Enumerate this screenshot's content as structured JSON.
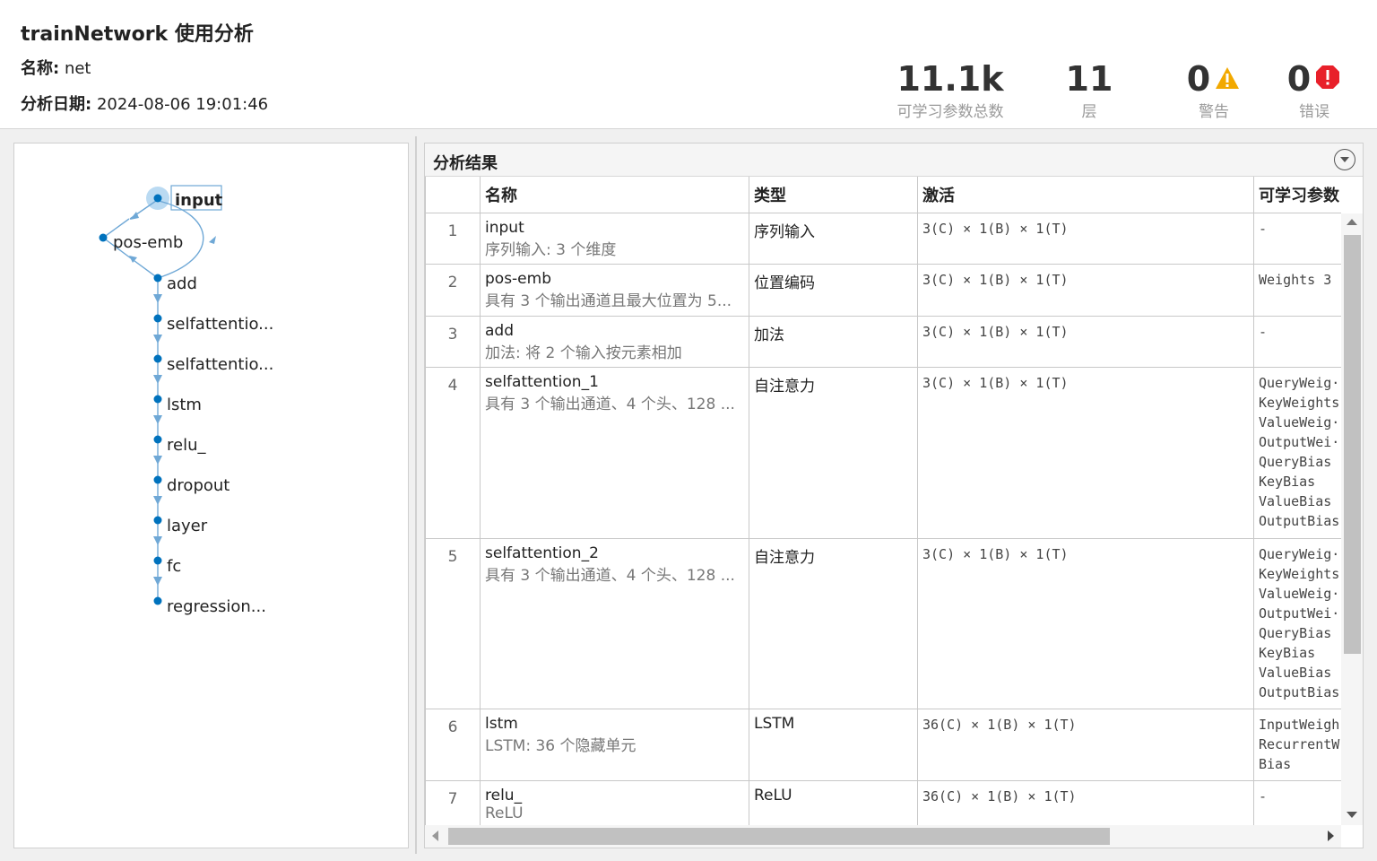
{
  "header": {
    "title": "trainNetwork 使用分析",
    "name_label": "名称:",
    "name_value": "net",
    "date_label": "分析日期:",
    "date_value": "2024-08-06 19:01:46"
  },
  "stats": {
    "params_value": "11.1k",
    "params_caption": "可学习参数总数",
    "layers_value": "11",
    "layers_caption": "层",
    "warnings_value": "0",
    "warnings_caption": "警告",
    "errors_value": "0",
    "errors_caption": "错误"
  },
  "graph": {
    "nodes": [
      "input",
      "pos-emb",
      "add",
      "selfattentio...",
      "selfattentio...",
      "lstm",
      "relu_",
      "dropout",
      "layer",
      "fc",
      "regression..."
    ]
  },
  "results": {
    "title": "分析结果",
    "columns": [
      "名称",
      "类型",
      "激活",
      "可学习参数"
    ],
    "rows": [
      {
        "idx": "1",
        "name": "input",
        "desc": "序列输入: 3 个维度",
        "type": "序列输入",
        "act": "3(C) × 1(B) × 1(T)",
        "params": [
          "-"
        ]
      },
      {
        "idx": "2",
        "name": "pos-emb",
        "desc": "具有 3 个输出通道且最大位置为 5...",
        "type": "位置编码",
        "act": "3(C) × 1(B) × 1(T)",
        "params": [
          "Weights  3"
        ]
      },
      {
        "idx": "3",
        "name": "add",
        "desc": "加法: 将 2 个输入按元素相加",
        "type": "加法",
        "act": "3(C) × 1(B) × 1(T)",
        "params": [
          "-"
        ]
      },
      {
        "idx": "4",
        "name": "selfattention_1",
        "desc": "具有 3 个输出通道、4 个头、128 ...",
        "type": "自注意力",
        "act": "3(C) × 1(B) × 1(T)",
        "params": [
          "QueryWeig··",
          "KeyWeights",
          "ValueWeig··",
          "OutputWei··",
          "QueryBias",
          "KeyBias",
          "ValueBias",
          "OutputBias"
        ]
      },
      {
        "idx": "5",
        "name": "selfattention_2",
        "desc": "具有 3 个输出通道、4 个头、128 ...",
        "type": "自注意力",
        "act": "3(C) × 1(B) × 1(T)",
        "params": [
          "QueryWeig··",
          "KeyWeights",
          "ValueWeig··",
          "OutputWei··",
          "QueryBias",
          "KeyBias",
          "ValueBias",
          "OutputBias"
        ]
      },
      {
        "idx": "6",
        "name": "lstm",
        "desc": "LSTM: 36 个隐藏单元",
        "type": "LSTM",
        "act": "36(C) × 1(B) × 1(T)",
        "params": [
          "InputWeigh",
          "RecurrentW",
          "Bias"
        ]
      },
      {
        "idx": "7",
        "name": "relu_",
        "desc": "ReLU",
        "type": "ReLU",
        "act": "36(C) × 1(B) × 1(T)",
        "params": [
          "-"
        ]
      }
    ]
  },
  "colors": {
    "node": "#0072bd",
    "edge": "#6fa8d6",
    "warning": "#f2a900",
    "error": "#e8202a"
  }
}
